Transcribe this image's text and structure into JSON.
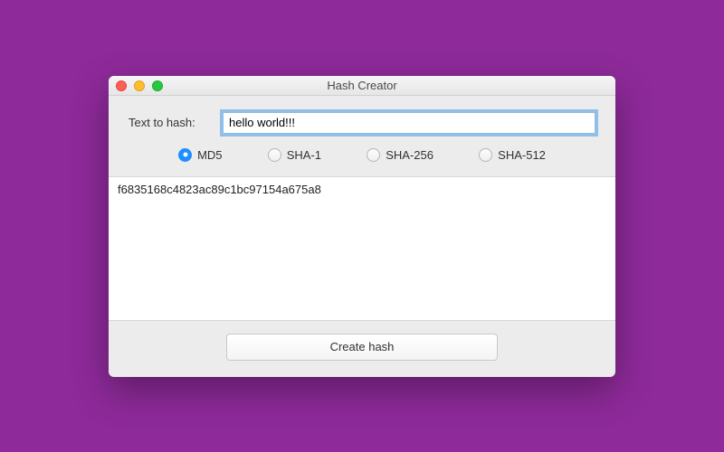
{
  "window": {
    "title": "Hash Creator"
  },
  "input": {
    "label": "Text to hash:",
    "value": "hello world!!!"
  },
  "algorithms": [
    {
      "label": "MD5",
      "selected": true
    },
    {
      "label": "SHA-1",
      "selected": false
    },
    {
      "label": "SHA-256",
      "selected": false
    },
    {
      "label": "SHA-512",
      "selected": false
    }
  ],
  "output": {
    "hash": "f6835168c4823ac89c1bc97154a675a8"
  },
  "actions": {
    "create_label": "Create hash"
  }
}
